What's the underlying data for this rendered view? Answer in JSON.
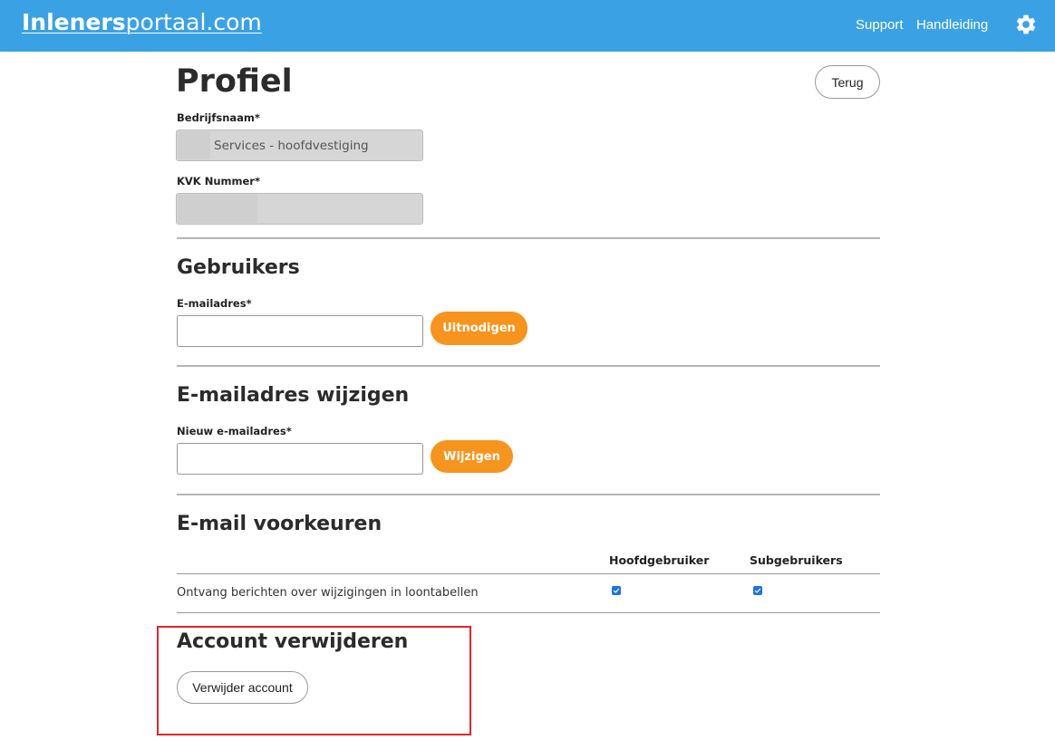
{
  "header": {
    "logo_bold": "Inleners",
    "logo_rest": "portaal.com",
    "support_label": "Support",
    "manual_label": "Handleiding",
    "settings_icon": "gear-icon"
  },
  "main": {
    "title": "Profiel",
    "back_label": "Terug",
    "company": {
      "label": "Bedrijfsnaam*",
      "value": "Services - hoofdvestiging"
    },
    "kvk": {
      "label": "KVK Nummer*",
      "value": ""
    },
    "users": {
      "heading": "Gebruikers",
      "email_label": "E-mailadres*",
      "email_value": "",
      "invite_label": "Uitnodigen"
    },
    "change_email": {
      "heading": "E-mailadres wijzigen",
      "new_email_label": "Nieuw e-mailadres*",
      "new_email_value": "",
      "change_label": "Wijzigen"
    },
    "email_prefs": {
      "heading": "E-mail voorkeuren",
      "columns": [
        "Hoofdgebruiker",
        "Subgebruikers"
      ],
      "rows": [
        {
          "label": "Ontvang berichten over wijzigingen in loontabellen",
          "main_user": true,
          "sub_users": true
        }
      ]
    },
    "delete_account": {
      "heading": "Account verwijderen",
      "button_label": "Verwijder account"
    }
  },
  "colors": {
    "header_bg": "#3aa2e4",
    "accent_orange": "#f7941d",
    "checkbox_blue": "#1a73e8",
    "highlight_red": "#e0262b"
  }
}
